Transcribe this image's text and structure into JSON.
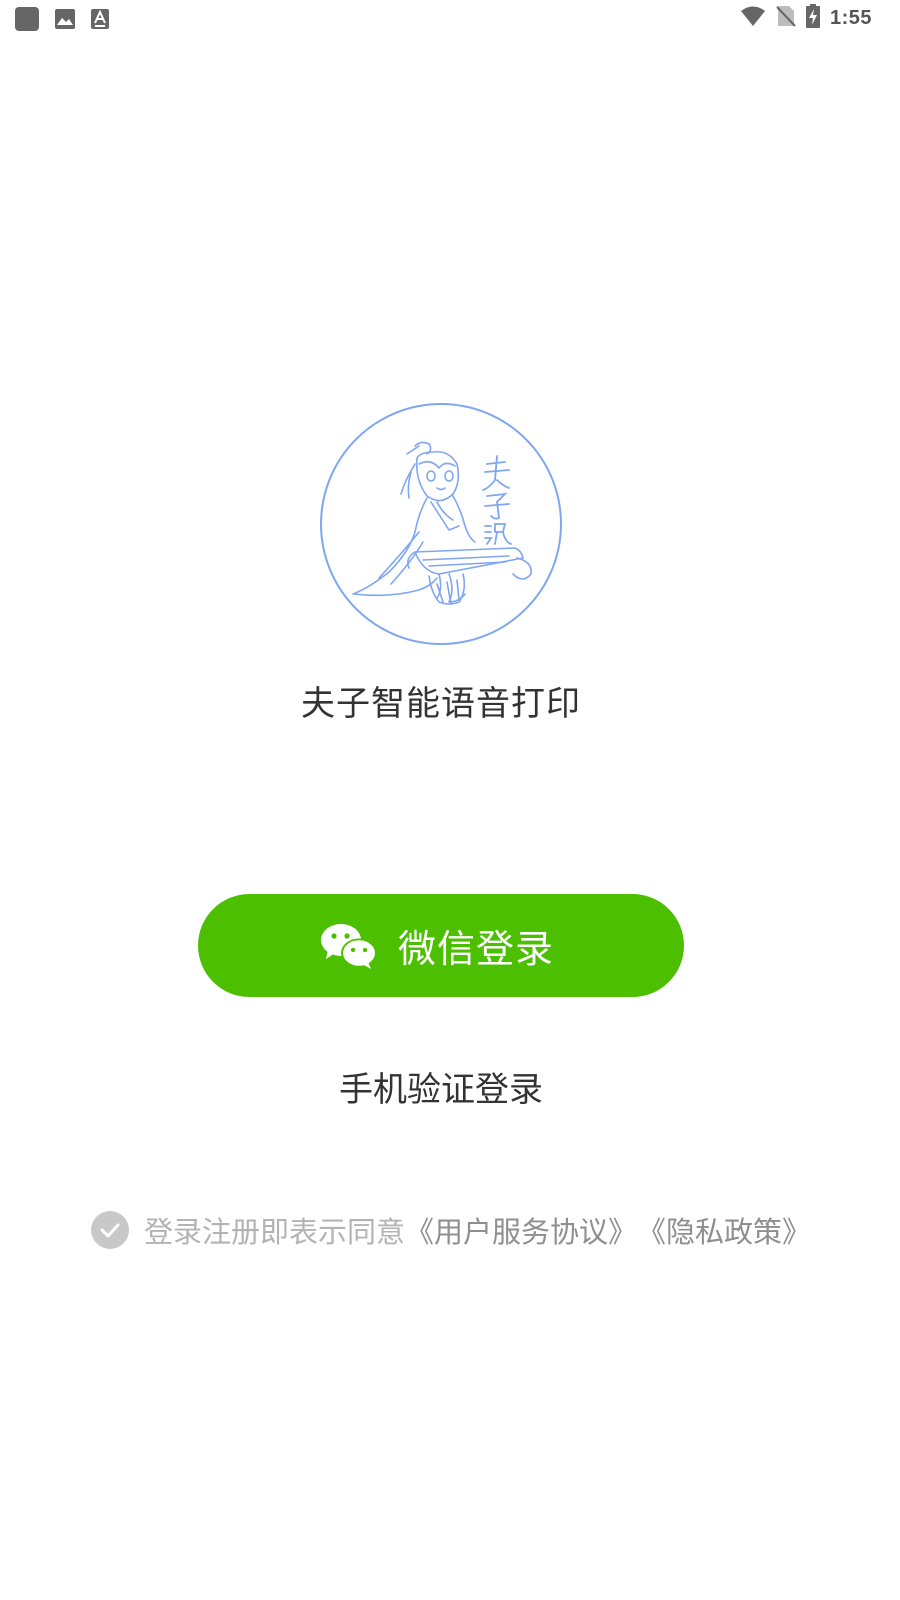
{
  "status_bar": {
    "time": "1:55",
    "left_icons": [
      "app-notification-icon",
      "image-notification-icon",
      "keyboard-notification-icon"
    ],
    "right_icons": [
      "wifi-icon",
      "no-sim-icon",
      "battery-charging-icon"
    ]
  },
  "app": {
    "title": "夫子智能语音打印",
    "logo_text": "夫子說"
  },
  "login": {
    "wechat_label": "微信登录",
    "phone_label": "手机验证登录"
  },
  "agreement": {
    "prefix": "登录注册即表示同意",
    "user_agreement": "《用户服务协议》",
    "privacy_policy": "《隐私政策》"
  },
  "colors": {
    "wechat_green": "#4cbf00",
    "logo_blue": "#7fa6f2",
    "text_dark": "#333333",
    "text_muted": "#b3b3b3",
    "check_gray": "#c8c8c8"
  }
}
